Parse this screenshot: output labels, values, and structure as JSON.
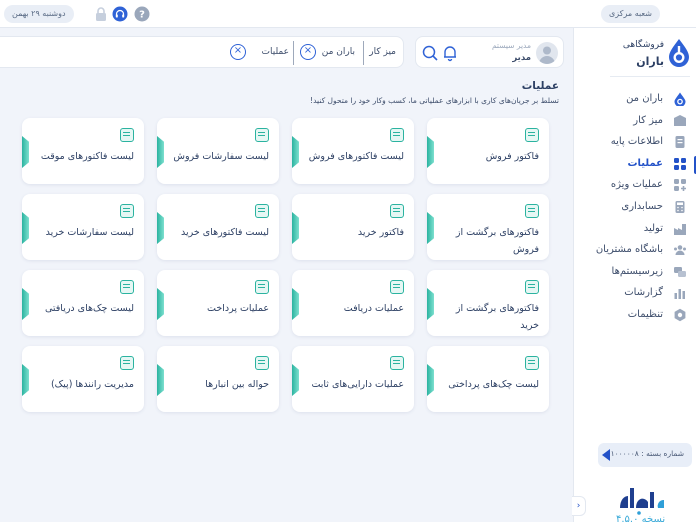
{
  "topbar": {
    "date": "دوشنبه ۲۹ بهمن",
    "branch": "شعبه مرکزی"
  },
  "brand": {
    "line1": "فروشگاهی",
    "line2": "باران"
  },
  "sidebar": {
    "items": [
      {
        "label": "باران من",
        "icon": "baran-logo-icon",
        "active": false
      },
      {
        "label": "میز کار",
        "icon": "desk-icon",
        "active": false
      },
      {
        "label": "اطلاعات پایه",
        "icon": "file-icon",
        "active": false
      },
      {
        "label": "عملیات",
        "icon": "grid-icon",
        "active": true
      },
      {
        "label": "عملیات ویژه",
        "icon": "grid-plus-icon",
        "active": false
      },
      {
        "label": "حسابداری",
        "icon": "calculator-icon",
        "active": false
      },
      {
        "label": "تولید",
        "icon": "factory-icon",
        "active": false
      },
      {
        "label": "باشگاه مشتریان",
        "icon": "customers-icon",
        "active": false
      },
      {
        "label": "زیرسیستم‌ها",
        "icon": "subsystems-icon",
        "active": false
      },
      {
        "label": "گزارشات",
        "icon": "chart-icon",
        "active": false
      },
      {
        "label": "تنظیمات",
        "icon": "gear-icon",
        "active": false
      }
    ],
    "pack_label": "شماره بسته : ۱۰۰۰۰۰۸",
    "version": "نسخه ۴.۵.۰"
  },
  "user": {
    "role": "مدیر سیستم",
    "name": "مدیر"
  },
  "tabs": [
    {
      "label": "میز کار"
    },
    {
      "label": "باران من"
    },
    {
      "label": "عملیات"
    }
  ],
  "section": {
    "title": "عملیات",
    "subtitle": "تسلط بر جریان‌های کاری با ابزارهای عملیاتی ما، کسب وکار خود را متحول کنید!"
  },
  "cards": [
    {
      "label": "فاکتور فروش",
      "icon": "invoice-icon"
    },
    {
      "label": "لیست فاکتورهای فروش",
      "icon": "invoice-list-icon"
    },
    {
      "label": "لیست سفارشات فروش",
      "icon": "basket-icon"
    },
    {
      "label": "لیست فاکتورهای موقت",
      "icon": "draft-list-icon"
    },
    {
      "label": "فاکتورهای برگشت از فروش",
      "icon": "return-invoice-icon"
    },
    {
      "label": "فاکتور خرید",
      "icon": "purchase-invoice-icon"
    },
    {
      "label": "لیست فاکتورهای خرید",
      "icon": "cart-icon"
    },
    {
      "label": "لیست سفارشات خرید",
      "icon": "cart-list-icon"
    },
    {
      "label": "فاکتورهای برگشت از خرید",
      "icon": "return-purchase-icon"
    },
    {
      "label": "عملیات دریافت",
      "icon": "receive-icon"
    },
    {
      "label": "عملیات پرداخت",
      "icon": "payment-icon"
    },
    {
      "label": "لیست چک‌های دریافتی",
      "icon": "cheque-receive-icon"
    },
    {
      "label": "لیست چک‌های پرداختی",
      "icon": "cheque-pay-icon"
    },
    {
      "label": "عملیات دارایی‌های ثابت",
      "icon": "asset-icon"
    },
    {
      "label": "حواله بین انبارها",
      "icon": "transfer-icon"
    },
    {
      "label": "مدیریت رانندها (پیک)",
      "icon": "courier-icon"
    }
  ],
  "colors": {
    "accent": "#2352c8",
    "card_accent": "#2bb3a0",
    "background": "#f1f4fa"
  }
}
